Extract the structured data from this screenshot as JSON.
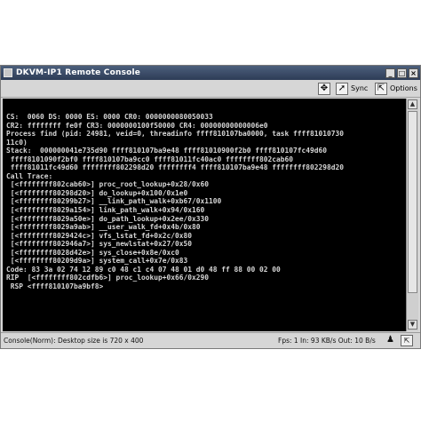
{
  "window": {
    "title": "DKVM-IP1 Remote Console"
  },
  "toolbar": {
    "sync_label": "Sync",
    "options_label": "Options"
  },
  "console": {
    "lines": [
      "CS:  0060 DS: 0000 ES: 0000 CR0: 0000000080050033",
      "CR2: ffffffff fe0f CR3: 0000000100f50000 CR4: 00000000000006e0",
      "Process find (pid: 24981, veid=0, threadinfo ffff810107ba0000, task ffff81010730",
      "11c0)",
      "Stack:  000000041e735d90 ffff810107ba9e48 ffff81010900f2b0 ffff810107fc49d60",
      " ffff8101090f2bf0 ffff810107ba9cc0 ffff81011fc40ac0 ffffffff802cab60",
      " ffff81011fc49d60 ffffffff802298d20 ffffffff4 ffff810107ba9e48 ffffffff802298d20",
      "Call Trace:",
      " [<ffffffff802cab60>] proc_root_lookup+0x28/0x60",
      " [<ffffffff80298d20>] do_lookup+0x100/0x1e0",
      " [<ffffffff80299b27>] __link_path_walk+0xb67/0x1100",
      " [<ffffffff8029a154>] link_path_walk+0x94/0x160",
      " [<ffffffff8029a50e>] do_path_lookup+0x2ee/0x330",
      " [<ffffffff8029a9ab>] __user_walk_fd+0x4b/0x80",
      " [<ffffffff8029424c>] vfs_lstat_fd+0x2c/0x80",
      " [<ffffffff802946a7>] sys_newlstat+0x27/0x50",
      " [<ffffffff8028d42e>] sys_close+0x8e/0xc0",
      " [<ffffffff80209d9a>] system_call+0x7e/0x83",
      "",
      "",
      "Code: 83 3a 02 74 12 89 c0 48 c1 c4 07 48 01 d0 48 ff 88 00 02 00",
      "RIP  [<ffffffff802cdfb6>] proc_lookup+0x66/0x290",
      " RSP <ffff810107ba9bf8>"
    ]
  },
  "status": {
    "left": "Console(Norm): Desktop size is 720 x 400",
    "right": "Fps: 1 In: 93 KB/s Out: 10 B/s"
  }
}
